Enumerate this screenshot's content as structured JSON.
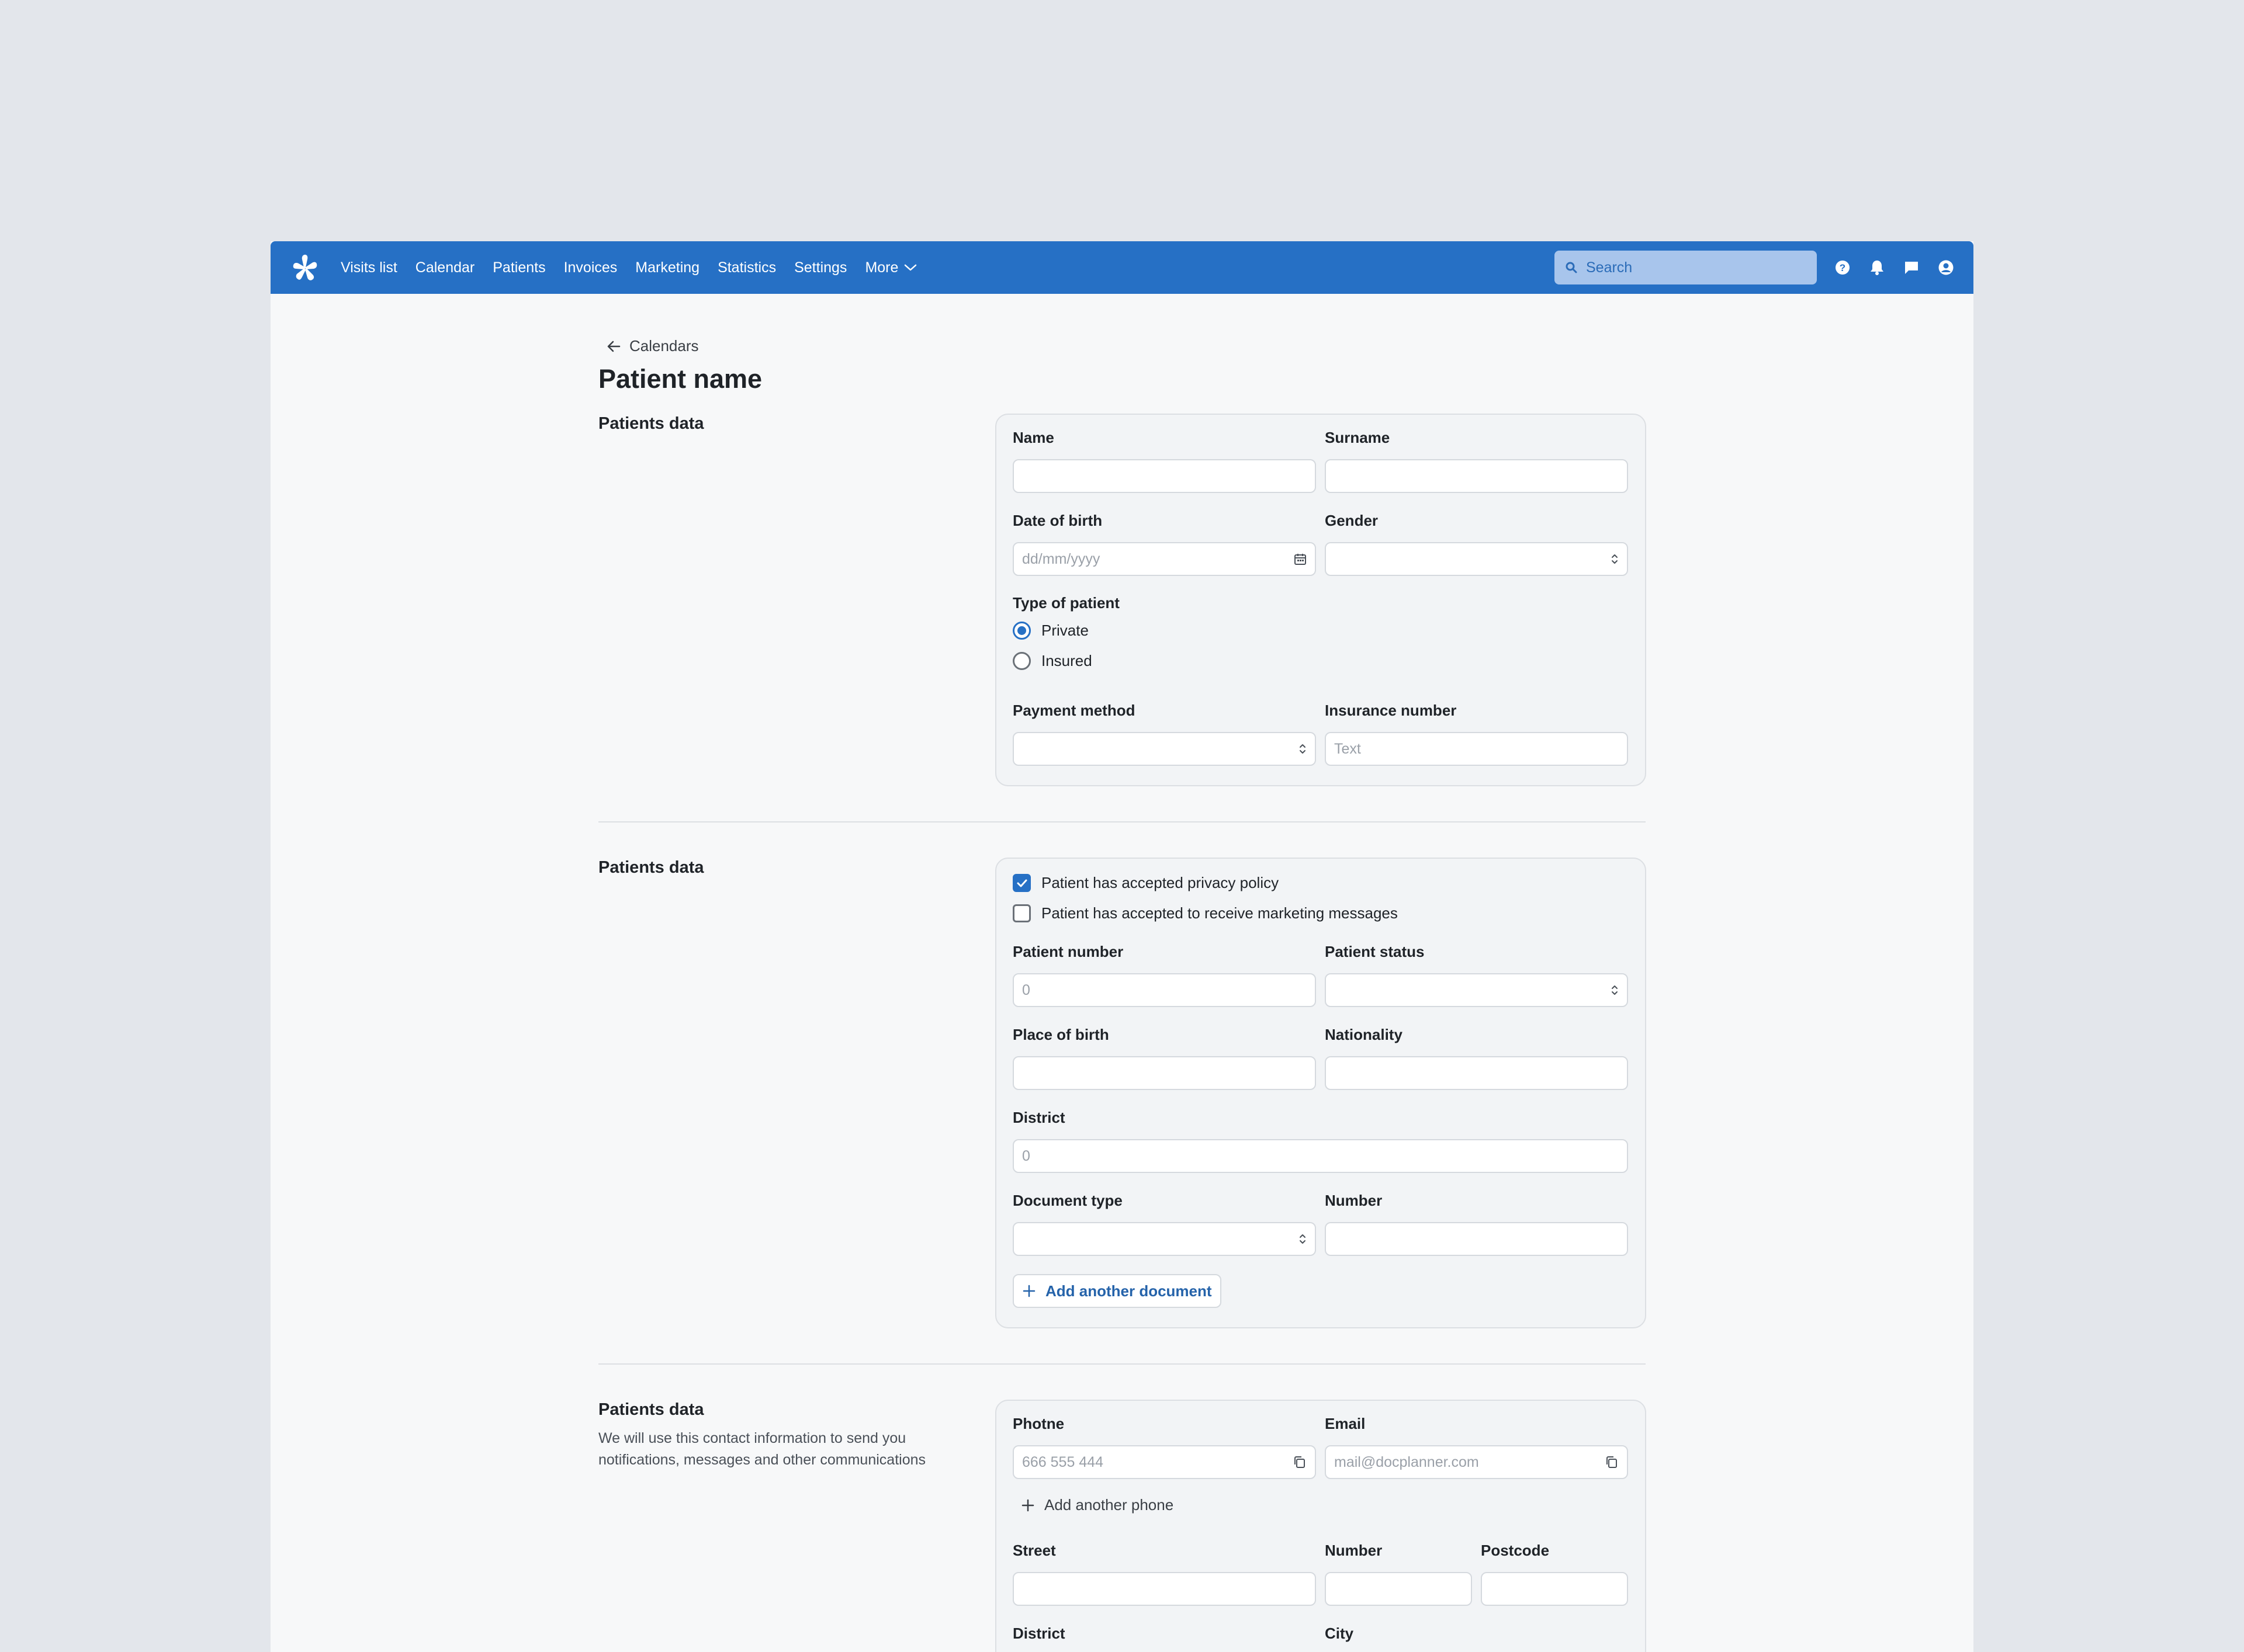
{
  "nav": {
    "items": [
      "Visits list",
      "Calendar",
      "Patients",
      "Invoices",
      "Marketing",
      "Statistics",
      "Settings"
    ],
    "more": "More",
    "search_placeholder": "Search"
  },
  "back_label": "Calendars",
  "page_title": "Patient name",
  "section1": {
    "title": "Patients data",
    "name_label": "Name",
    "surname_label": "Surname",
    "dob_label": "Date of birth",
    "dob_placeholder": "dd/mm/yyyy",
    "gender_label": "Gender",
    "type_label": "Type of patient",
    "type_options": [
      {
        "label": "Private",
        "checked": true
      },
      {
        "label": "Insured",
        "checked": false
      }
    ],
    "payment_label": "Payment method",
    "insurance_label": "Insurance number",
    "insurance_placeholder": "Text"
  },
  "section2": {
    "title": "Patients data",
    "privacy_label": "Patient has accepted privacy policy",
    "privacy_checked": true,
    "marketing_label": "Patient has accepted to receive marketing messages",
    "marketing_checked": false,
    "patient_number_label": "Patient number",
    "patient_number_placeholder": "0",
    "patient_status_label": "Patient status",
    "place_of_birth_label": "Place of birth",
    "nationality_label": "Nationality",
    "district_label": "District",
    "district_placeholder": "0",
    "doc_type_label": "Document type",
    "number_label": "Number",
    "add_document_label": "Add another document"
  },
  "section3": {
    "title": "Patients data",
    "description": "We will use this contact information to send you notifications, messages and other communications",
    "phone_label": "Photne",
    "phone_placeholder": "666 555 444",
    "email_label": "Email",
    "email_placeholder": "mail@docplanner.com",
    "add_phone_label": "Add another phone",
    "street_label": "Street",
    "number_label": "Number",
    "postcode_label": "Postcode",
    "district_label": "District",
    "city_label": "City"
  },
  "colors": {
    "brand": "#2670c5",
    "page_bg": "#e3e6eb",
    "card_bg": "#f2f4f6"
  }
}
